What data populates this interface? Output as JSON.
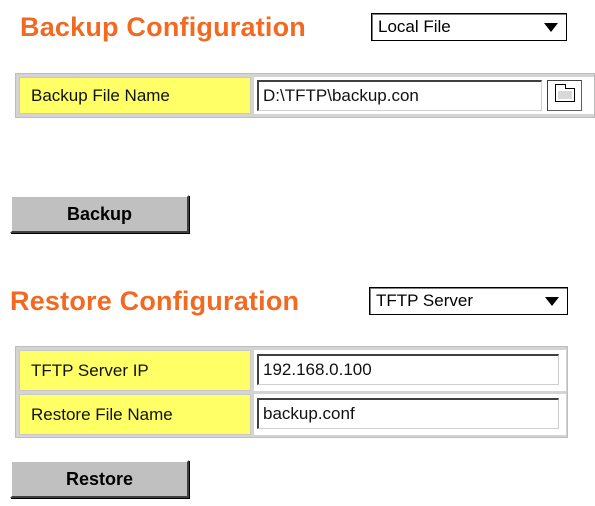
{
  "backup": {
    "heading": "Backup Configuration",
    "mode_select": {
      "value": "Local File"
    },
    "file_name_label": "Backup File Name",
    "file_name_value": "D:\\TFTP\\backup.con",
    "browse_icon": "folder-icon",
    "button_label": "Backup"
  },
  "restore": {
    "heading": "Restore Configuration",
    "mode_select": {
      "value": "TFTP Server"
    },
    "server_ip_label": "TFTP Server IP",
    "server_ip_value": "192.168.0.100",
    "file_name_label": "Restore File Name",
    "file_name_value": "backup.conf",
    "button_label": "Restore"
  },
  "colors": {
    "heading": "#f26a21",
    "label_bg": "#ffff66",
    "button_bg": "#c0c0c0"
  }
}
